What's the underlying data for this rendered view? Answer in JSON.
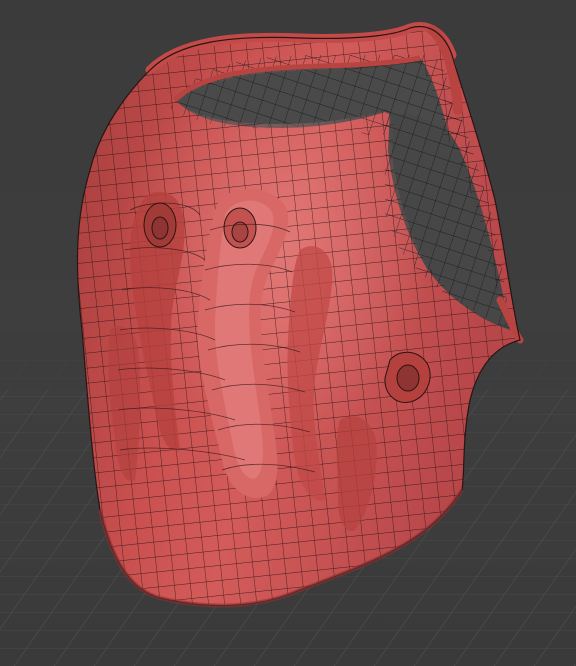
{
  "viewport": {
    "background_color": "#3d3d3d",
    "grid_line_color": "#4a4a4a",
    "grid_visible": true
  },
  "mesh": {
    "object": "breastplate",
    "display": "wireframe-over-solid",
    "surface_color": "#c9504f",
    "highlight_color": "#e07a78",
    "shadow_color": "#8e3533",
    "wire_color": "#2a1414",
    "inner_surface_color": "#4a4a4a",
    "inner_wire_color": "#1e1e1e"
  }
}
